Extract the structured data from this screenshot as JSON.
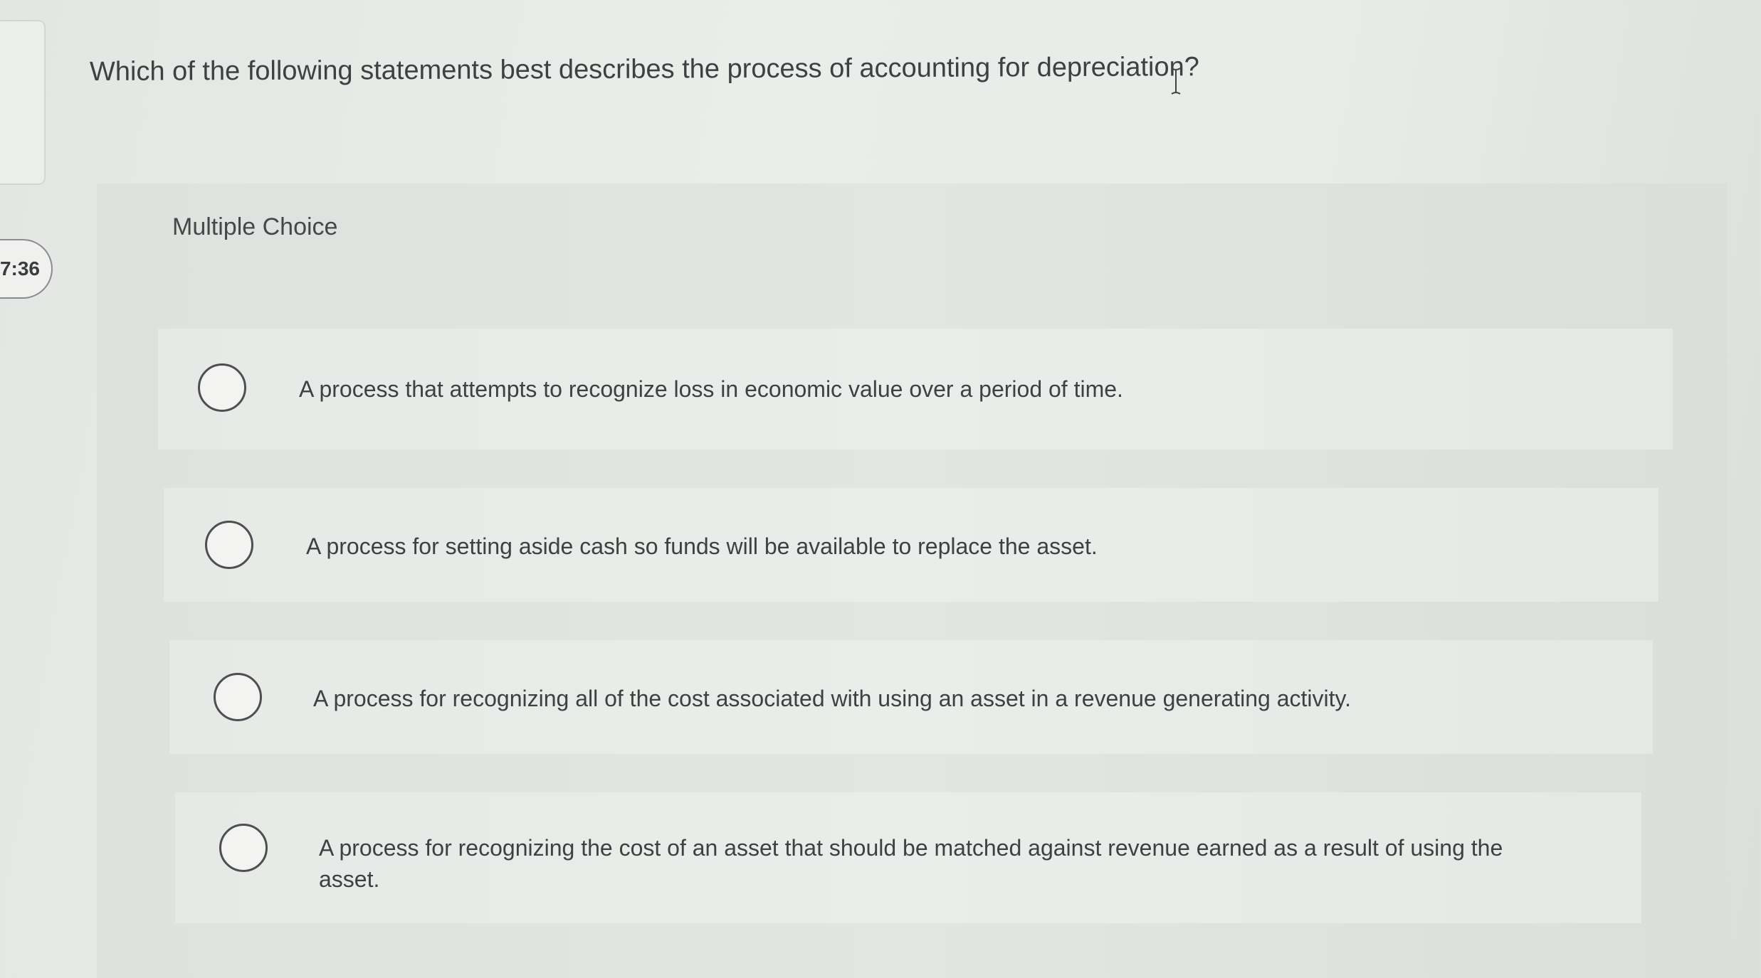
{
  "timer": {
    "value": "7:36"
  },
  "question": {
    "text": "Which of the following statements best describes the process of accounting for depreciation?"
  },
  "multiple_choice": {
    "label": "Multiple Choice",
    "options": [
      {
        "text": "A process that attempts to recognize loss in economic value over a period of time."
      },
      {
        "text": "A process for setting aside cash so funds will be available to replace the asset."
      },
      {
        "text": "A process for recognizing all of the cost associated with using an asset in a revenue generating activity."
      },
      {
        "text": "A process for recognizing the cost of an asset that should be matched against revenue earned as a result of using the asset."
      }
    ]
  },
  "icons": {
    "cursor": "text-cursor-icon",
    "radio": "radio-button-icon"
  }
}
